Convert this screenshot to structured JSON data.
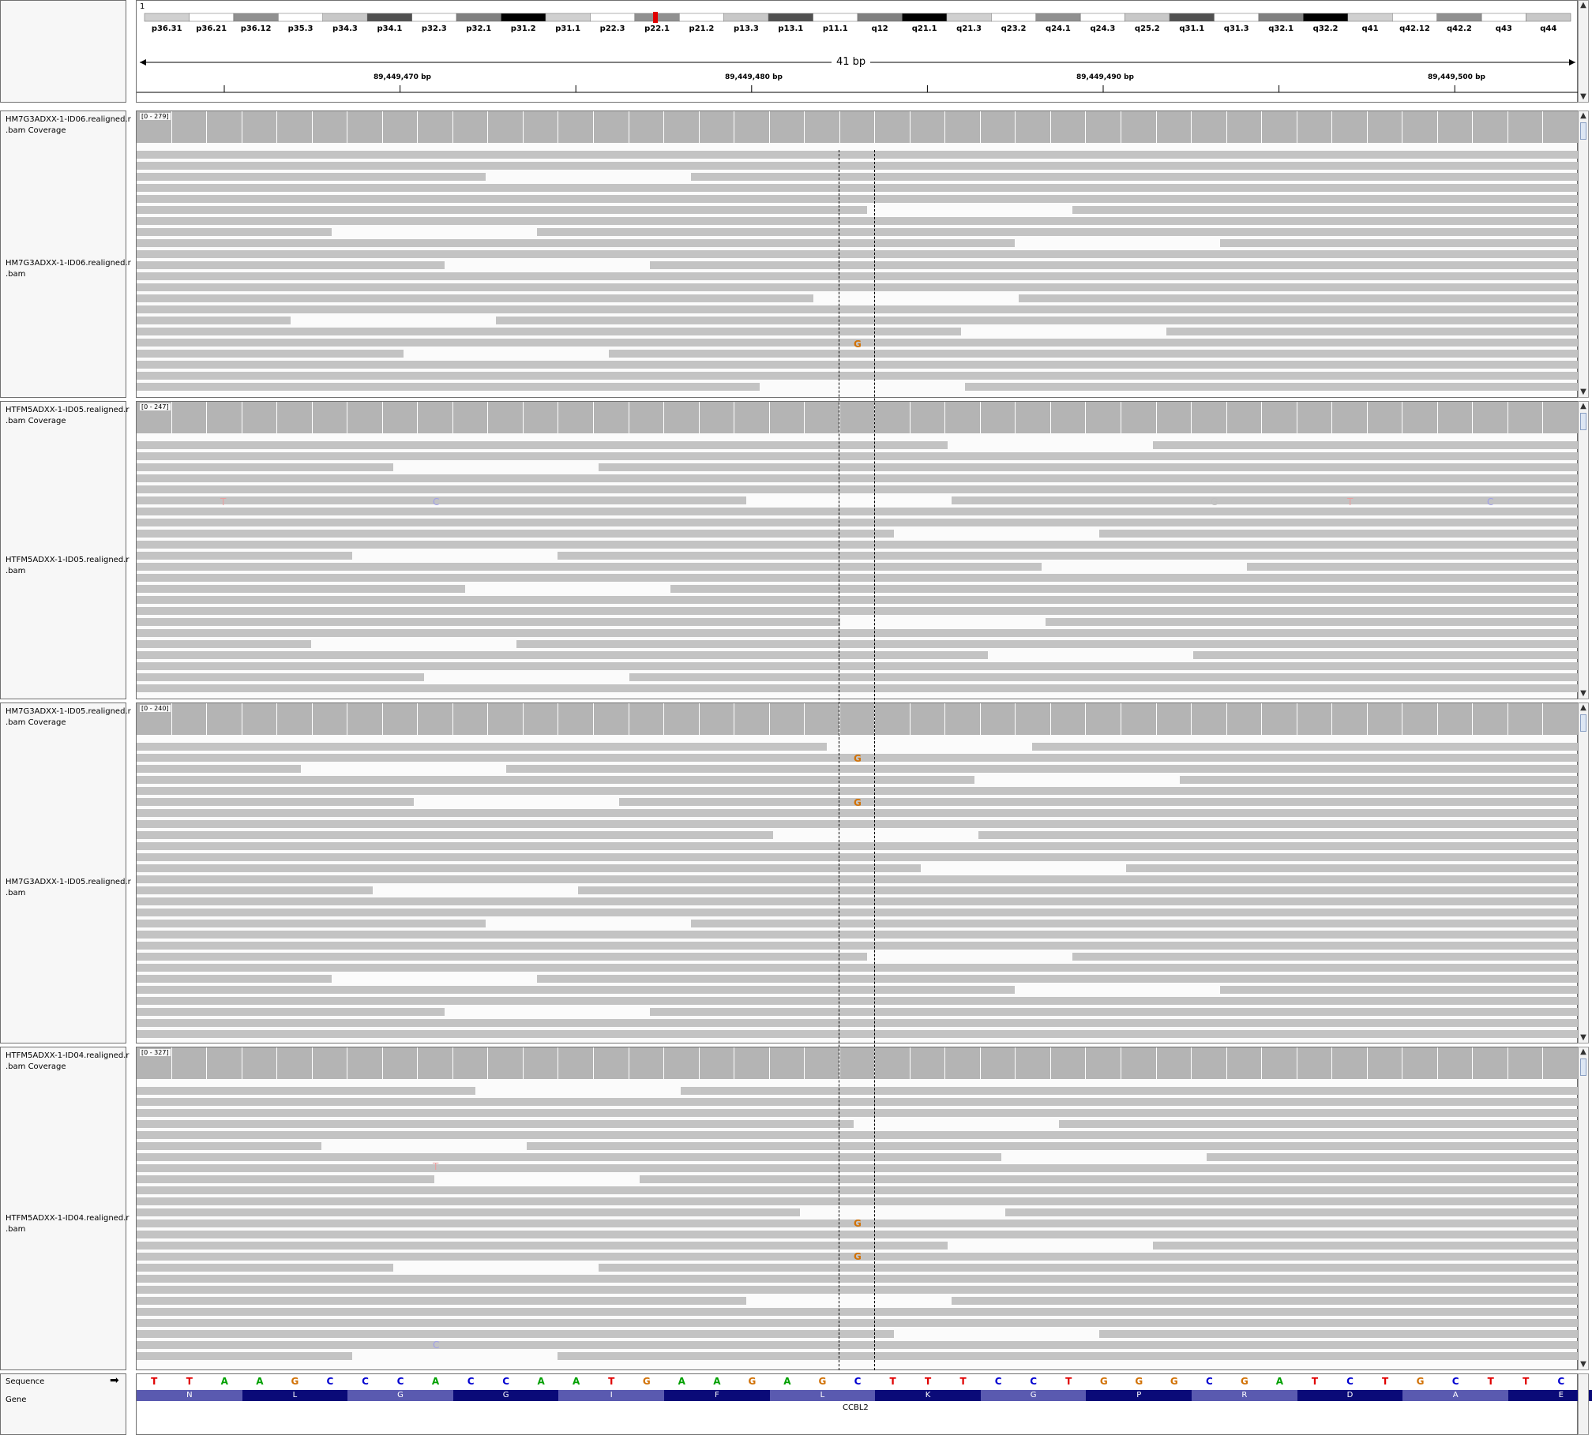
{
  "ruler": {
    "chromosome": "1",
    "span_label": "41 bp",
    "positions": [
      "89,449,470 bp",
      "89,449,480 bp",
      "89,449,490 bp",
      "89,449,500 bp"
    ],
    "cytobands": [
      "p36.31",
      "p36.21",
      "p36.12",
      "p35.3",
      "p34.3",
      "p34.1",
      "p32.3",
      "p32.1",
      "p31.2",
      "p31.1",
      "p22.3",
      "p22.1",
      "p21.2",
      "p13.3",
      "p13.1",
      "p11.1",
      "q12",
      "q21.1",
      "q21.3",
      "q23.2",
      "q24.1",
      "q24.3",
      "q25.2",
      "q31.1",
      "q31.3",
      "q32.1",
      "q32.2",
      "q41",
      "q42.12",
      "q42.2",
      "q43",
      "q44"
    ]
  },
  "panels": [
    {
      "coverage_name": "HM7G3ADXX-1-ID06.realigned.r\n.bam Coverage",
      "bam_name": "HM7G3ADXX-1-ID06.realigned.r\n.bam",
      "range": "[0 - 279]",
      "mismatches": [
        "G"
      ]
    },
    {
      "coverage_name": "HTFM5ADXX-1-ID05.realigned.r\n.bam Coverage",
      "bam_name": "HTFM5ADXX-1-ID05.realigned.r\n.bam",
      "range": "[0 - 247]",
      "mismatches": [
        "T",
        "C",
        "G",
        "T",
        "C"
      ]
    },
    {
      "coverage_name": "HM7G3ADXX-1-ID05.realigned.r\n.bam Coverage",
      "bam_name": "HM7G3ADXX-1-ID05.realigned.r\n.bam",
      "range": "[0 - 240]",
      "mismatches": [
        "G",
        "G"
      ]
    },
    {
      "coverage_name": "HTFM5ADXX-1-ID04.realigned.r\n.bam Coverage",
      "bam_name": "HTFM5ADXX-1-ID04.realigned.r\n.bam",
      "range": "[0 - 327]",
      "mismatches": [
        "T",
        "G",
        "G",
        "C"
      ]
    }
  ],
  "sequence": {
    "label": "Sequence",
    "arrow": "➡",
    "bases": [
      "T",
      "T",
      "A",
      "A",
      "G",
      "C",
      "C",
      "C",
      "A",
      "C",
      "C",
      "A",
      "A",
      "T",
      "G",
      "A",
      "A",
      "G",
      "A",
      "G",
      "C",
      "T",
      "T",
      "T",
      "C",
      "C",
      "T",
      "G",
      "G",
      "G",
      "C",
      "G",
      "A",
      "T",
      "C",
      "T",
      "G",
      "C",
      "T",
      "T",
      "C"
    ]
  },
  "gene": {
    "label": "Gene",
    "amino_acids": [
      "N",
      "L",
      "G",
      "G",
      "I",
      "F",
      "L",
      "K",
      "G",
      "P",
      "R",
      "D",
      "A",
      "E"
    ],
    "name": "CCBL2"
  },
  "colors": {
    "A": "#00a000",
    "C": "#0000d0",
    "G": "#d17105",
    "T": "#e00000"
  }
}
